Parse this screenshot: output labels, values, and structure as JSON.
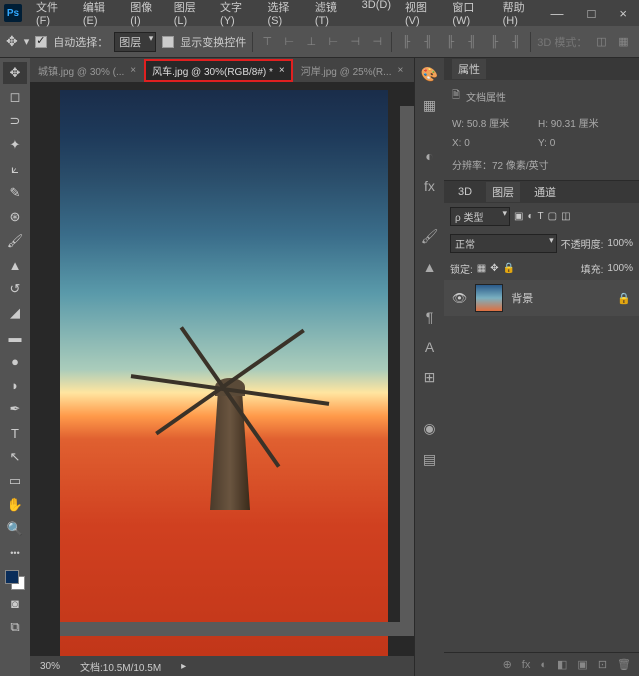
{
  "titlebar": {
    "logo": "Ps"
  },
  "menu": [
    "文件(F)",
    "编辑(E)",
    "图像(I)",
    "图层(L)",
    "文字(Y)",
    "选择(S)",
    "滤镜(T)",
    "3D(D)",
    "视图(V)",
    "窗口(W)",
    "帮助(H)"
  ],
  "win": {
    "min": "—",
    "max": "□",
    "close": "×"
  },
  "optbar": {
    "auto_select": "自动选择：",
    "layer": "图层",
    "show_transform": "显示变换控件",
    "mode3d": "3D 模式："
  },
  "tabs": [
    {
      "label": "城镇.jpg @ 30% (...",
      "active": false,
      "hl": false
    },
    {
      "label": "风车.jpg @ 30%(RGB/8#) *",
      "active": true,
      "hl": true
    },
    {
      "label": "河岸.jpg @ 25%(R...",
      "active": false,
      "hl": false
    }
  ],
  "status": {
    "zoom": "30%",
    "doc": "文档:10.5M/10.5M"
  },
  "props": {
    "title": "属性",
    "doctitle": "文档属性",
    "w_lbl": "W:",
    "w_val": "50.8 厘米",
    "h_lbl": "H:",
    "h_val": "90.31 厘米",
    "x_lbl": "X:",
    "x_val": "0",
    "y_lbl": "Y:",
    "y_val": "0",
    "res": "分辨率：72 像素/英寸"
  },
  "layerspanel": {
    "tab_3d": "3D",
    "tab_layers": "图层",
    "tab_channels": "通道",
    "kind": "ρ 类型",
    "mode": "正常",
    "opacity_lbl": "不透明度:",
    "opacity": "100%",
    "lock_lbl": "锁定:",
    "fill_lbl": "填充:",
    "fill": "100%",
    "layer_name": "背景"
  },
  "footicons": [
    "⊕",
    "fx",
    "◐",
    "◧",
    "▣",
    "⊡",
    "🗑"
  ]
}
